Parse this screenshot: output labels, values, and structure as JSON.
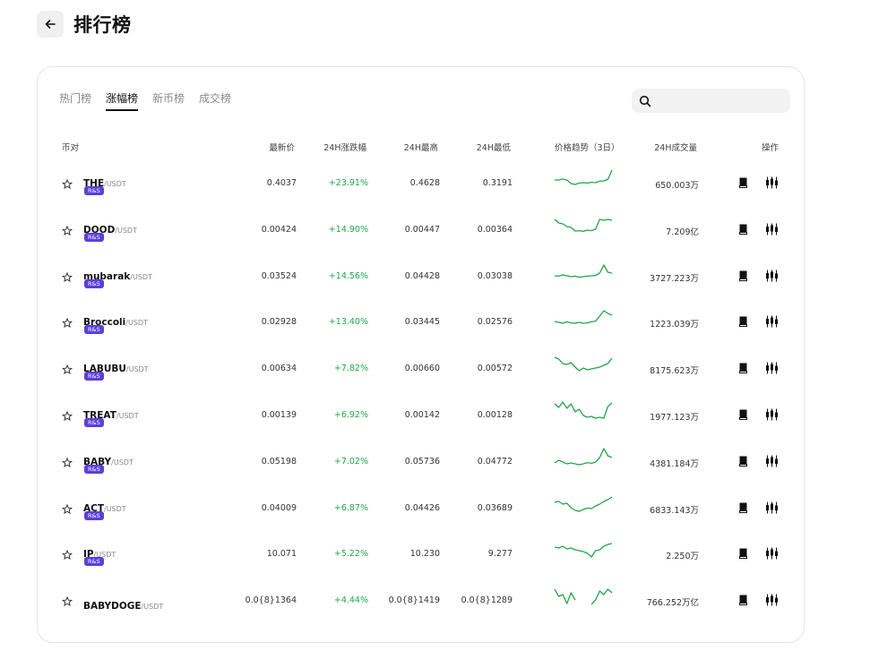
{
  "header": {
    "title": "排行榜",
    "back_icon": "arrow-left-icon"
  },
  "tabs": [
    {
      "label": "热门榜",
      "active": false
    },
    {
      "label": "涨幅榜",
      "active": true
    },
    {
      "label": "新币榜",
      "active": false
    },
    {
      "label": "成交榜",
      "active": false
    }
  ],
  "search": {
    "value": "",
    "placeholder": "",
    "icon": "search-icon"
  },
  "columns": {
    "pair": "币对",
    "price": "最新价",
    "change": "24H涨跌幅",
    "high": "24H最高",
    "low": "24H最低",
    "trend": "价格趋势（3日）",
    "volume": "24H成交量",
    "action": "操作"
  },
  "colors": {
    "accent_green": "#1fa64a",
    "badge": "#5b3fd9",
    "text": "#1e1e1e"
  },
  "rows": [
    {
      "base": "THE",
      "quote": "/USDT",
      "badge": "R&S",
      "price": "0.4037",
      "change": "+23.91%",
      "high": "0.4628",
      "low": "0.3191",
      "volume": "650.003万",
      "trend": [
        0.55,
        0.55,
        0.5,
        0.55,
        0.75,
        0.8,
        0.72,
        0.7,
        0.72,
        0.68,
        0.7,
        0.62,
        0.6,
        0.52,
        0.0
      ]
    },
    {
      "base": "DOOD",
      "quote": "/USDT",
      "badge": "R&S",
      "price": "0.00424",
      "change": "+14.90%",
      "high": "0.00447",
      "low": "0.00364",
      "volume": "7.209亿",
      "trend": [
        0.15,
        0.35,
        0.4,
        0.55,
        0.6,
        0.8,
        0.78,
        0.82,
        0.75,
        0.78,
        0.7,
        0.15,
        0.2,
        0.15,
        0.2
      ]
    },
    {
      "base": "mubarak",
      "quote": "/USDT",
      "badge": "R&S",
      "price": "0.03524",
      "change": "+14.56%",
      "high": "0.04428",
      "low": "0.03038",
      "volume": "3727.223万",
      "trend": [
        0.7,
        0.72,
        0.65,
        0.7,
        0.75,
        0.72,
        0.78,
        0.75,
        0.72,
        0.7,
        0.68,
        0.55,
        0.1,
        0.5,
        0.55
      ]
    },
    {
      "base": "Broccoli",
      "quote": "/USDT",
      "badge": "R&S",
      "price": "0.02928",
      "change": "+13.40%",
      "high": "0.03445",
      "low": "0.02576",
      "volume": "1223.039万",
      "trend": [
        0.7,
        0.75,
        0.8,
        0.72,
        0.78,
        0.8,
        0.75,
        0.8,
        0.78,
        0.72,
        0.68,
        0.4,
        0.1,
        0.25,
        0.35
      ]
    },
    {
      "base": "LABUBU",
      "quote": "/USDT",
      "badge": "R&S",
      "price": "0.00634",
      "change": "+7.82%",
      "high": "0.00660",
      "low": "0.00572",
      "volume": "8175.623万",
      "trend": [
        0.1,
        0.2,
        0.45,
        0.5,
        0.4,
        0.65,
        0.85,
        0.7,
        0.8,
        0.75,
        0.7,
        0.65,
        0.55,
        0.45,
        0.15
      ]
    },
    {
      "base": "TREAT",
      "quote": "/USDT",
      "badge": "R&S",
      "price": "0.00139",
      "change": "+6.92%",
      "high": "0.00142",
      "low": "0.00128",
      "volume": "1977.123万",
      "trend": [
        0.1,
        0.3,
        0.0,
        0.35,
        0.1,
        0.55,
        0.4,
        0.75,
        0.85,
        0.8,
        0.9,
        0.85,
        0.9,
        0.25,
        0.05
      ]
    },
    {
      "base": "BABY",
      "quote": "/USDT",
      "badge": "R&S",
      "price": "0.05198",
      "change": "+7.02%",
      "high": "0.05736",
      "low": "0.04772",
      "volume": "4381.184万",
      "trend": [
        0.8,
        0.65,
        0.75,
        0.85,
        0.8,
        0.85,
        0.9,
        0.85,
        0.78,
        0.82,
        0.75,
        0.5,
        0.0,
        0.4,
        0.5
      ]
    },
    {
      "base": "ACT",
      "quote": "/USDT",
      "badge": "R&S",
      "price": "0.04009",
      "change": "+6.87%",
      "high": "0.04426",
      "low": "0.03689",
      "volume": "6833.143万",
      "trend": [
        0.4,
        0.35,
        0.5,
        0.45,
        0.7,
        0.85,
        0.9,
        0.8,
        0.72,
        0.75,
        0.6,
        0.5,
        0.35,
        0.25,
        0.1
      ]
    },
    {
      "base": "IP",
      "quote": "/USDT",
      "badge": "R&S",
      "price": "10.071",
      "change": "+5.22%",
      "high": "10.230",
      "low": "9.277",
      "volume": "2.250万",
      "trend": [
        0.35,
        0.4,
        0.3,
        0.45,
        0.4,
        0.5,
        0.55,
        0.6,
        0.7,
        0.9,
        0.55,
        0.5,
        0.3,
        0.2,
        0.15
      ]
    },
    {
      "base": "BABYDOGE",
      "quote": "/USDT",
      "badge": "",
      "price": "0.0{8}1364",
      "change": "+4.44%",
      "high": "0.0{8}1419",
      "low": "0.0{8}1289",
      "volume": "766.252万亿",
      "trend": [
        0.1,
        0.5,
        0.4,
        0.9,
        0.3,
        0.7,
        null,
        null,
        null,
        0.95,
        0.7,
        0.2,
        0.4,
        0.1,
        0.3
      ]
    }
  ]
}
